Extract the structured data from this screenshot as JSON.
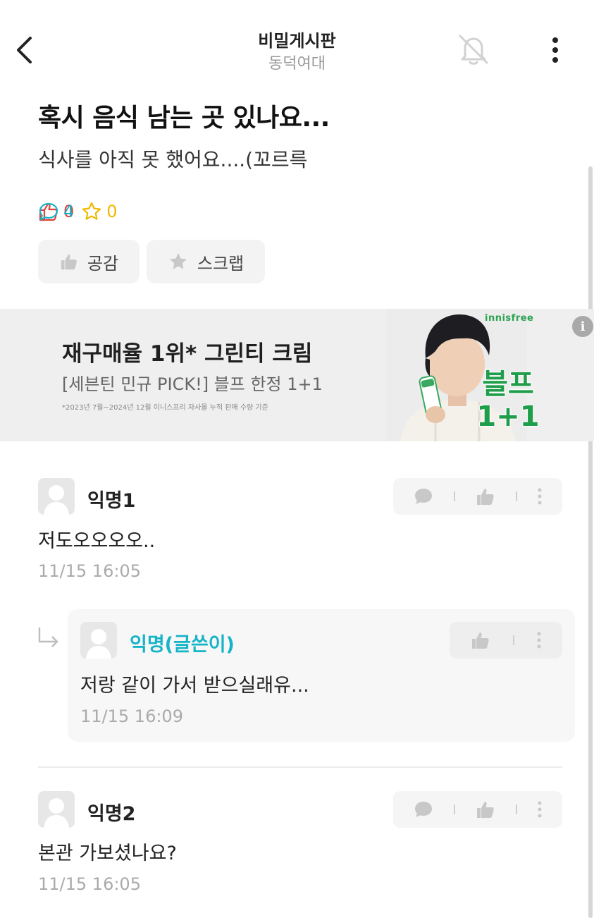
{
  "header": {
    "title": "비밀게시판",
    "subtitle": "동덕여대",
    "icons": {
      "back": "chevron-left-icon",
      "bell": "bell-off-icon",
      "more": "more-vertical-icon"
    }
  },
  "post": {
    "title": "혹시 음식 남는 곳 있나요...",
    "body": "식사를 아직 못 했어요....(꼬르륵",
    "stats": {
      "likes": "0",
      "comments": "4",
      "scraps": "0"
    },
    "colors": {
      "like": "#e0403a",
      "comment": "#16b4c7",
      "scrap": "#f0b800"
    },
    "buttons": {
      "empathy": "공감",
      "scrap": "스크랩"
    }
  },
  "ad": {
    "headline": "재구매율 1위* 그린티 크림",
    "subline": "[세븐틴 민규 PICK!] 블프 한정 1+1",
    "fine_print": "*2023년 7월~2024년 12월 이니스프리 자사몰 누적 판매 수량 기준",
    "brand": "innisfree",
    "badge_line1": "블프",
    "badge_line2": "1+1",
    "info_label": "i"
  },
  "comments": [
    {
      "author": "익명1",
      "text": "저도오오오오..",
      "time": "11/15 16:05"
    },
    {
      "author": "익명(글쓴이)",
      "text": "저랑 같이 가서 받으실래유...",
      "time": "11/15 16:09",
      "is_reply": true,
      "is_op": true
    },
    {
      "author": "익명2",
      "text": "본관 가보셨나요?",
      "time": "11/15 16:05"
    }
  ]
}
